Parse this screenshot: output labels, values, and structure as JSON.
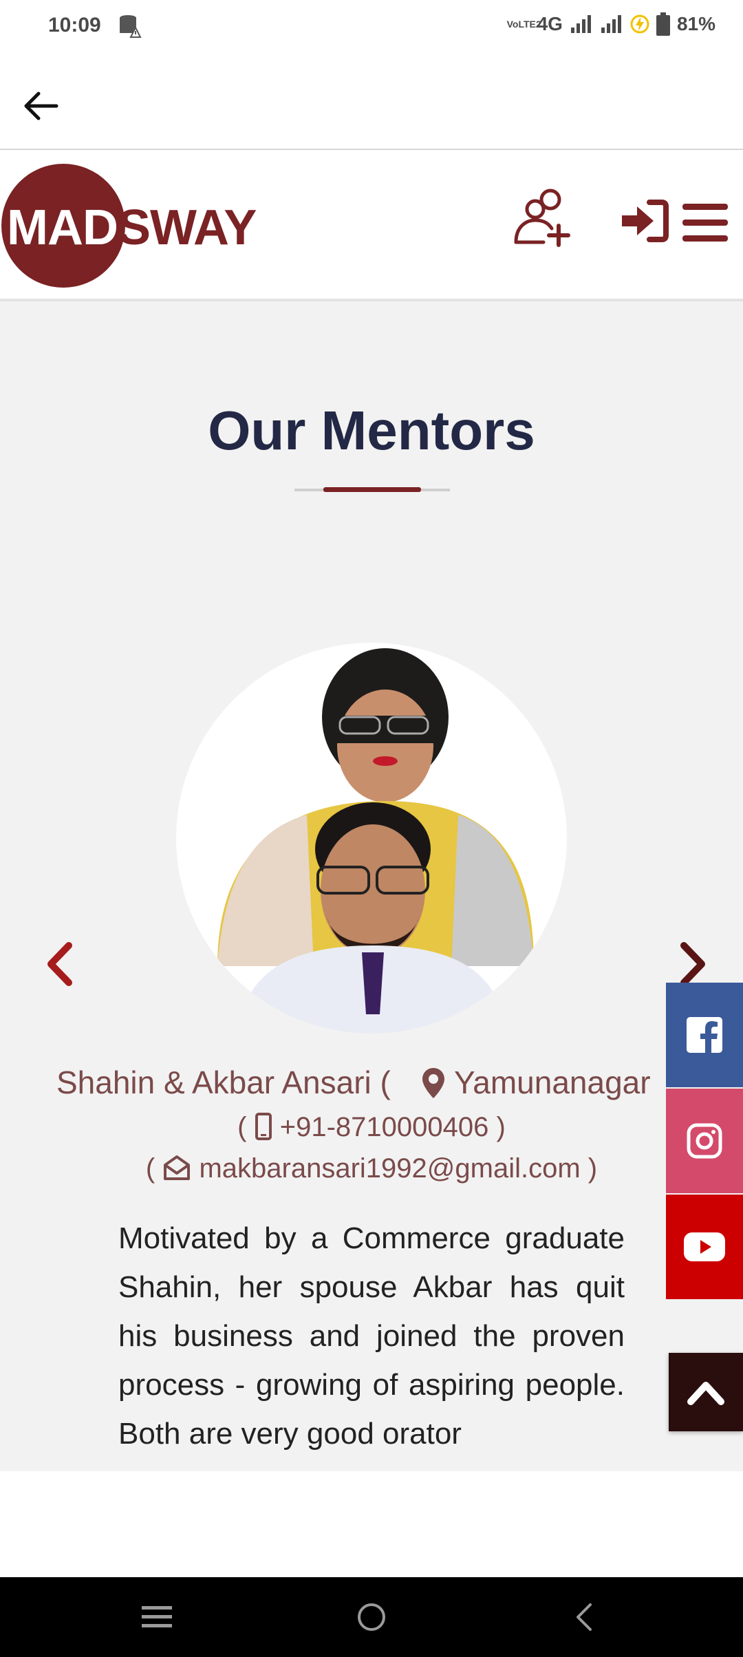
{
  "status_bar": {
    "time": "10:09",
    "network_label": "VoLTE2",
    "network_type": "4G",
    "battery": "81%"
  },
  "header": {
    "logo_left": "MAD",
    "logo_right": "SWAY"
  },
  "section": {
    "title": "Our Mentors"
  },
  "mentor": {
    "name_line": "Shahin & Akbar Ansari (",
    "location": "Yamunanagar",
    "phone_open": "(",
    "phone": "+91-8710000406",
    "phone_close": ")",
    "email_open": "(",
    "email": "makbaransari1992@gmail.com",
    "email_close": ")",
    "bio": "Motivated by a Commerce graduate Shahin, her spouse Akbar has quit his business and joined the proven process - growing of aspiring people. Both are very good orator"
  },
  "colors": {
    "brand": "#7a2224",
    "title": "#232846",
    "facebook": "#3b5a9a",
    "instagram": "#d44a6a",
    "youtube": "#cc0000"
  },
  "icons": [
    "back-arrow-icon",
    "add-user-icon",
    "login-icon",
    "menu-icon",
    "chevron-left-icon",
    "chevron-right-icon",
    "location-pin-icon",
    "phone-icon",
    "email-icon",
    "facebook-icon",
    "instagram-icon",
    "youtube-icon",
    "chevron-up-icon"
  ]
}
